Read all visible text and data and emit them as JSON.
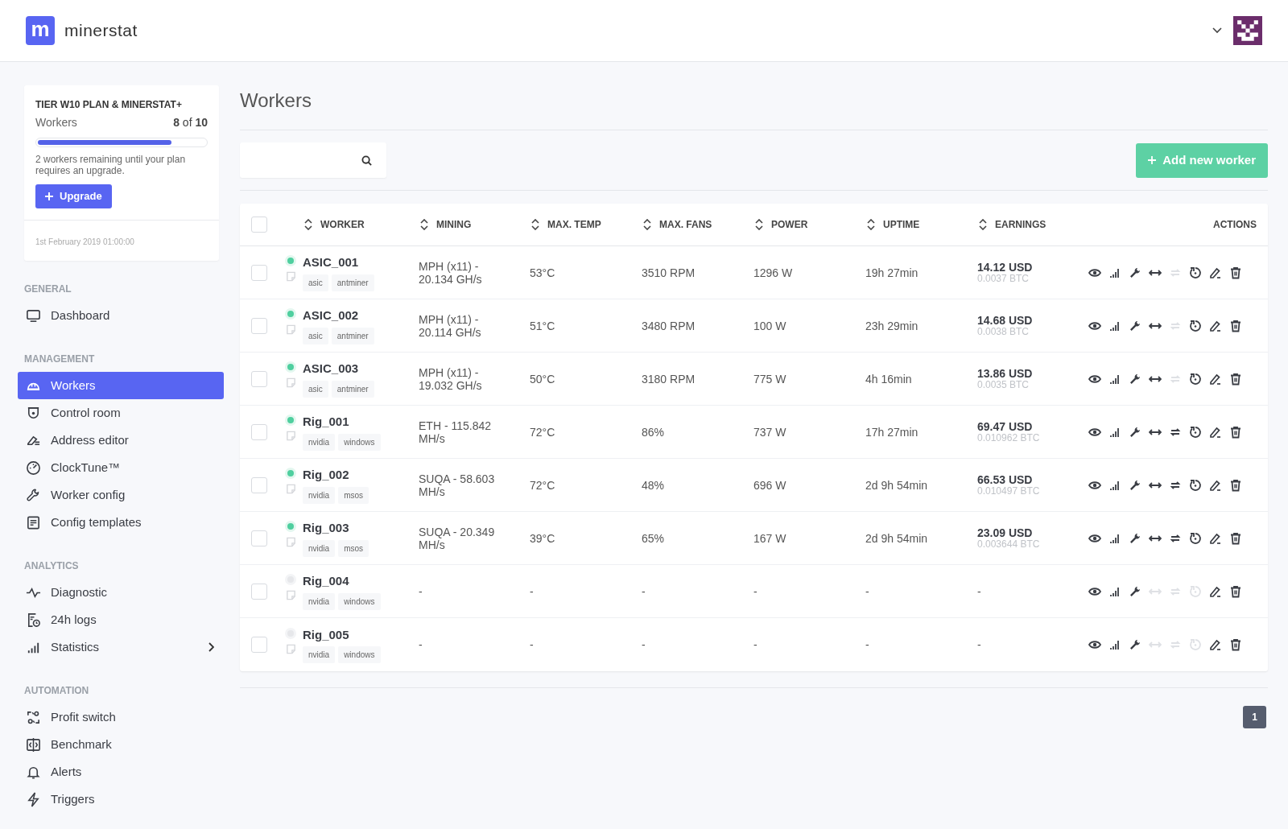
{
  "brand": {
    "logo_letter": "m",
    "name": "minerstat"
  },
  "plan": {
    "title": "TIER W10 PLAN & MINERSTAT+",
    "workers_label": "Workers",
    "count": "**8** of **10**",
    "level": 0.8,
    "note": "2 workers remaining until your plan requires an upgrade.",
    "upgrade_button": "Upgrade",
    "date": "1st February 2019 01:00:00"
  },
  "sidebar": [
    {
      "heading": "GENERAL",
      "items": [
        {
          "label": "Dashboard",
          "kind": "monitor",
          "selected": false,
          "submenu": false
        }
      ]
    },
    {
      "heading": "MANAGEMENT",
      "items": [
        {
          "label": "Workers",
          "kind": "helmet",
          "selected": true,
          "submenu": false
        },
        {
          "label": "Control room",
          "kind": "shield",
          "selected": false,
          "submenu": false
        },
        {
          "label": "Address editor",
          "kind": "eraser",
          "selected": false,
          "submenu": false
        },
        {
          "label": "ClockTune™",
          "kind": "gauge",
          "selected": false,
          "submenu": false
        },
        {
          "label": "Worker config",
          "kind": "wrench",
          "selected": false,
          "submenu": false
        },
        {
          "label": "Config templates",
          "kind": "document",
          "selected": false,
          "submenu": false
        }
      ]
    },
    {
      "heading": "ANALYTICS",
      "items": [
        {
          "label": "Diagnostic",
          "kind": "pulse",
          "selected": false,
          "submenu": false
        },
        {
          "label": "24h logs",
          "kind": "logclock",
          "selected": false,
          "submenu": false
        },
        {
          "label": "Statistics",
          "kind": "bars",
          "selected": false,
          "submenu": true
        }
      ]
    },
    {
      "heading": "AUTOMATION",
      "items": [
        {
          "label": "Profit switch",
          "kind": "switch",
          "selected": false,
          "submenu": false
        },
        {
          "label": "Benchmark",
          "kind": "compare",
          "selected": false,
          "submenu": false
        },
        {
          "label": "Alerts",
          "kind": "bell",
          "selected": false,
          "submenu": false
        },
        {
          "label": "Triggers",
          "kind": "bolt",
          "selected": false,
          "submenu": false
        }
      ]
    }
  ],
  "page_title": "Workers",
  "add_button": "Add new worker",
  "table": {
    "select_all_checked": false,
    "columns": [
      "WORKER",
      "MINING",
      "MAX. TEMP",
      "MAX. FANS",
      "POWER",
      "UPTIME",
      "EARNINGS",
      "ACTIONS"
    ],
    "rows": [
      {
        "checked": false,
        "online": true,
        "name": "ASIC_001",
        "tags": [
          "asic",
          "antminer"
        ],
        "mining": "MPH (x11) - 20.134 GH/s",
        "temp": "53°C",
        "fans": "3510 RPM",
        "power": "1296 W",
        "uptime": "19h 27min",
        "usd": "14.12 USD",
        "btc": "0.0037 BTC",
        "actions": [
          {
            "kind": "view",
            "disabled": false
          },
          {
            "kind": "stats",
            "disabled": false
          },
          {
            "kind": "config",
            "disabled": false
          },
          {
            "kind": "move",
            "disabled": false
          },
          {
            "kind": "sync",
            "disabled": true
          },
          {
            "kind": "restart",
            "disabled": false
          },
          {
            "kind": "edit",
            "disabled": false
          },
          {
            "kind": "delete",
            "disabled": false
          }
        ]
      },
      {
        "checked": false,
        "online": true,
        "name": "ASIC_002",
        "tags": [
          "asic",
          "antminer"
        ],
        "mining": "MPH (x11) - 20.114 GH/s",
        "temp": "51°C",
        "fans": "3480 RPM",
        "power": "100 W",
        "uptime": "23h 29min",
        "usd": "14.68 USD",
        "btc": "0.0038 BTC",
        "actions": [
          {
            "kind": "view",
            "disabled": false
          },
          {
            "kind": "stats",
            "disabled": false
          },
          {
            "kind": "config",
            "disabled": false
          },
          {
            "kind": "move",
            "disabled": false
          },
          {
            "kind": "sync",
            "disabled": true
          },
          {
            "kind": "restart",
            "disabled": false
          },
          {
            "kind": "edit",
            "disabled": false
          },
          {
            "kind": "delete",
            "disabled": false
          }
        ]
      },
      {
        "checked": false,
        "online": true,
        "name": "ASIC_003",
        "tags": [
          "asic",
          "antminer"
        ],
        "mining": "MPH (x11) - 19.032 GH/s",
        "temp": "50°C",
        "fans": "3180 RPM",
        "power": "775 W",
        "uptime": "4h 16min",
        "usd": "13.86 USD",
        "btc": "0.0035 BTC",
        "actions": [
          {
            "kind": "view",
            "disabled": false
          },
          {
            "kind": "stats",
            "disabled": false
          },
          {
            "kind": "config",
            "disabled": false
          },
          {
            "kind": "move",
            "disabled": false
          },
          {
            "kind": "sync",
            "disabled": true
          },
          {
            "kind": "restart",
            "disabled": false
          },
          {
            "kind": "edit",
            "disabled": false
          },
          {
            "kind": "delete",
            "disabled": false
          }
        ]
      },
      {
        "checked": false,
        "online": true,
        "name": "Rig_001",
        "tags": [
          "nvidia",
          "windows"
        ],
        "mining": "ETH - 115.842 MH/s",
        "temp": "72°C",
        "fans": "86%",
        "power": "737 W",
        "uptime": "17h 27min",
        "usd": "69.47 USD",
        "btc": "0.010962 BTC",
        "actions": [
          {
            "kind": "view",
            "disabled": false
          },
          {
            "kind": "stats",
            "disabled": false
          },
          {
            "kind": "config",
            "disabled": false
          },
          {
            "kind": "move",
            "disabled": false
          },
          {
            "kind": "sync",
            "disabled": false
          },
          {
            "kind": "restart",
            "disabled": false
          },
          {
            "kind": "edit",
            "disabled": false
          },
          {
            "kind": "delete",
            "disabled": false
          }
        ]
      },
      {
        "checked": false,
        "online": true,
        "name": "Rig_002",
        "tags": [
          "nvidia",
          "msos"
        ],
        "mining": "SUQA - 58.603 MH/s",
        "temp": "72°C",
        "fans": "48%",
        "power": "696 W",
        "uptime": "2d 9h 54min",
        "usd": "66.53 USD",
        "btc": "0.010497 BTC",
        "actions": [
          {
            "kind": "view",
            "disabled": false
          },
          {
            "kind": "stats",
            "disabled": false
          },
          {
            "kind": "config",
            "disabled": false
          },
          {
            "kind": "move",
            "disabled": false
          },
          {
            "kind": "sync",
            "disabled": false
          },
          {
            "kind": "restart",
            "disabled": false
          },
          {
            "kind": "edit",
            "disabled": false
          },
          {
            "kind": "delete",
            "disabled": false
          }
        ]
      },
      {
        "checked": false,
        "online": true,
        "name": "Rig_003",
        "tags": [
          "nvidia",
          "msos"
        ],
        "mining": "SUQA - 20.349 MH/s",
        "temp": "39°C",
        "fans": "65%",
        "power": "167 W",
        "uptime": "2d 9h 54min",
        "usd": "23.09 USD",
        "btc": "0.003644 BTC",
        "actions": [
          {
            "kind": "view",
            "disabled": false
          },
          {
            "kind": "stats",
            "disabled": false
          },
          {
            "kind": "config",
            "disabled": false
          },
          {
            "kind": "move",
            "disabled": false
          },
          {
            "kind": "sync",
            "disabled": false
          },
          {
            "kind": "restart",
            "disabled": false
          },
          {
            "kind": "edit",
            "disabled": false
          },
          {
            "kind": "delete",
            "disabled": false
          }
        ]
      },
      {
        "checked": false,
        "online": false,
        "name": "Rig_004",
        "tags": [
          "nvidia",
          "windows"
        ],
        "mining": "-",
        "temp": "-",
        "fans": "-",
        "power": "-",
        "uptime": "-",
        "usd": "-",
        "actions": [
          {
            "kind": "view",
            "disabled": false
          },
          {
            "kind": "stats",
            "disabled": false
          },
          {
            "kind": "config",
            "disabled": false
          },
          {
            "kind": "move",
            "disabled": true
          },
          {
            "kind": "sync",
            "disabled": true
          },
          {
            "kind": "restart",
            "disabled": true
          },
          {
            "kind": "edit",
            "disabled": false
          },
          {
            "kind": "delete",
            "disabled": false
          }
        ]
      },
      {
        "checked": false,
        "online": false,
        "name": "Rig_005",
        "tags": [
          "nvidia",
          "windows"
        ],
        "mining": "-",
        "temp": "-",
        "fans": "-",
        "power": "-",
        "uptime": "-",
        "usd": "-",
        "actions": [
          {
            "kind": "view",
            "disabled": false
          },
          {
            "kind": "stats",
            "disabled": false
          },
          {
            "kind": "config",
            "disabled": false
          },
          {
            "kind": "move",
            "disabled": true
          },
          {
            "kind": "sync",
            "disabled": true
          },
          {
            "kind": "restart",
            "disabled": true
          },
          {
            "kind": "edit",
            "disabled": false
          },
          {
            "kind": "delete",
            "disabled": false
          }
        ]
      }
    ]
  },
  "pagination": [
    {
      "label": "1",
      "selected": true
    }
  ]
}
